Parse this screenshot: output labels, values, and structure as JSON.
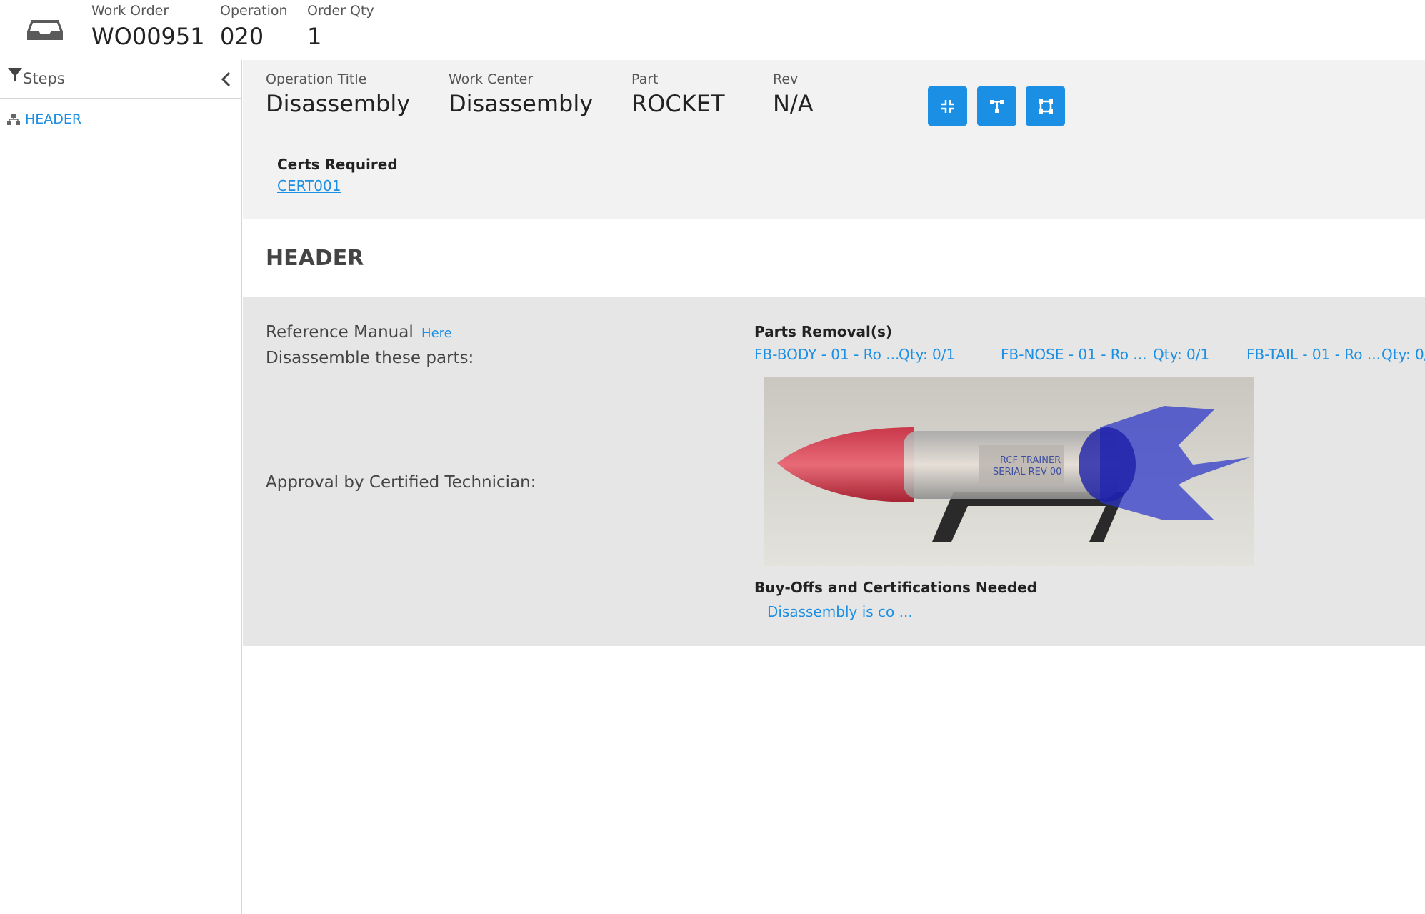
{
  "header": {
    "work_order": {
      "label": "Work Order",
      "value": "WO00951"
    },
    "operation": {
      "label": "Operation",
      "value": "020"
    },
    "order_qty": {
      "label": "Order Qty",
      "value": "1"
    }
  },
  "sidebar": {
    "title": "Steps",
    "items": [
      {
        "label": "HEADER"
      }
    ]
  },
  "operation": {
    "title": {
      "label": "Operation Title",
      "value": "Disassembly"
    },
    "work_center": {
      "label": "Work Center",
      "value": "Disassembly"
    },
    "part": {
      "label": "Part",
      "value": "ROCKET"
    },
    "rev": {
      "label": "Rev",
      "value": "N/A"
    },
    "certs": {
      "label": "Certs Required",
      "link": "CERT001"
    }
  },
  "section": {
    "title": "HEADER"
  },
  "step": {
    "reference_manual": "Reference Manual",
    "here_link": "Here",
    "instruction": "Disassemble these parts:",
    "approval": "Approval by Certified Technician:",
    "parts_removal_title": "Parts Removal(s)",
    "parts": [
      {
        "name": "FB-BODY - 01 - Ro ...",
        "qty": "Qty: 0/1"
      },
      {
        "name": "FB-NOSE - 01 - Ro ...",
        "qty": "Qty: 0/1"
      },
      {
        "name": "FB-TAIL - 01 - Ro ...",
        "qty": "Qty: 0/"
      }
    ],
    "buyoffs_title": "Buy-Offs and Certifications Needed",
    "buyoff_link": "Disassembly is co ..."
  },
  "colors": {
    "accent": "#1a8fe3",
    "panel": "#f2f2f2",
    "step_bg": "#e6e6e6"
  },
  "icons": {
    "inbox": "inbox-icon",
    "filter": "filter-icon",
    "collapse": "chevron-left-icon",
    "tree": "hierarchy-icon",
    "btn1": "compress-icon",
    "btn2": "network-icon",
    "btn3": "expand-icon"
  }
}
